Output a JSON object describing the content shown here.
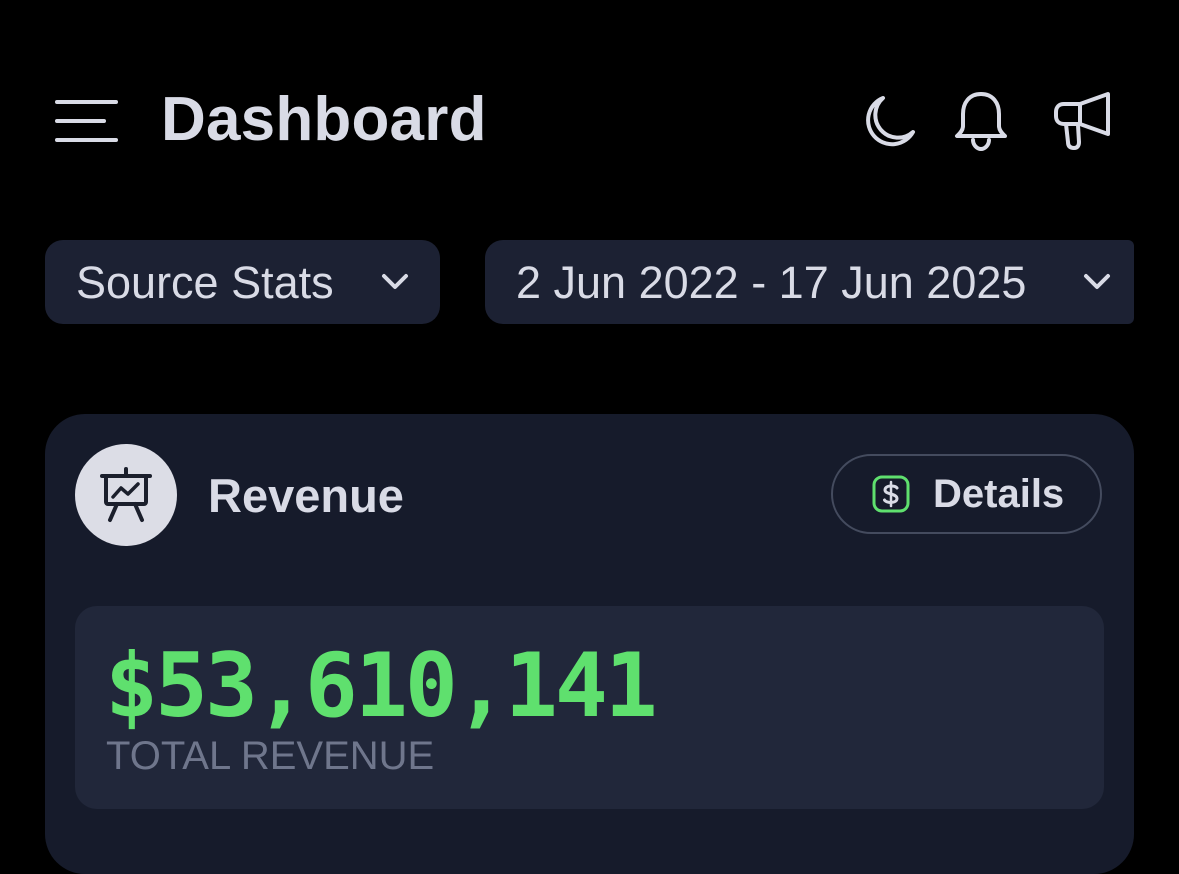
{
  "header": {
    "title": "Dashboard",
    "icons": {
      "menu": "hamburger-menu-icon",
      "theme": "moon-icon",
      "notifications": "bell-icon",
      "announcements": "megaphone-icon"
    }
  },
  "filters": {
    "source": {
      "label": "Source Stats",
      "icon": "chevron-down-icon"
    },
    "date_range": {
      "label": "2 Jun 2022 - 17 Jun 2025",
      "icon": "chevron-down-icon"
    }
  },
  "revenue_card": {
    "icon": "presentation-chart-icon",
    "title": "Revenue",
    "details_button": {
      "label": "Details",
      "icon": "dollar-square-icon"
    },
    "total": {
      "value": "$53,610,141",
      "label": "TOTAL REVENUE"
    }
  },
  "colors": {
    "background": "#000000",
    "surface": "#1c2133",
    "card": "#161b2b",
    "stat_box": "#21273a",
    "text": "#d9dbe6",
    "muted_text": "#6f768c",
    "accent_green": "#5fe06e"
  }
}
